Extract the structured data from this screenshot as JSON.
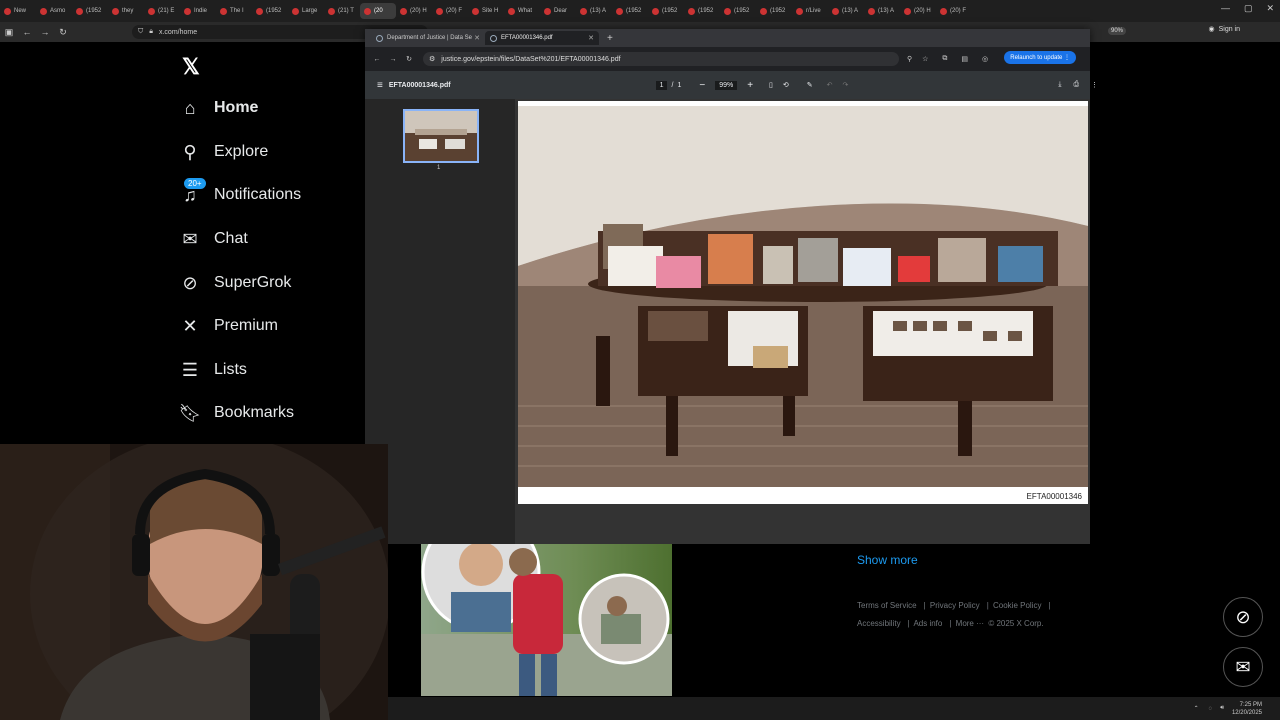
{
  "browser": {
    "tabs": [
      {
        "label": "New"
      },
      {
        "label": "Asmo"
      },
      {
        "label": "(1952"
      },
      {
        "label": "they"
      },
      {
        "label": "(21) E"
      },
      {
        "label": "Indie"
      },
      {
        "label": "The I"
      },
      {
        "label": "(1952"
      },
      {
        "label": "Large"
      },
      {
        "label": "(21) T"
      },
      {
        "label": "(20"
      },
      {
        "label": "(20) H"
      },
      {
        "label": "(20) F"
      },
      {
        "label": "Site H"
      },
      {
        "label": "What"
      },
      {
        "label": "Dear"
      },
      {
        "label": "(13) A"
      },
      {
        "label": "(1952"
      },
      {
        "label": "(1952"
      },
      {
        "label": "(1952"
      },
      {
        "label": "(1952"
      },
      {
        "label": "(1952"
      },
      {
        "label": "r/Live"
      },
      {
        "label": "(13) A"
      },
      {
        "label": "(13) A"
      },
      {
        "label": "(20) H"
      },
      {
        "label": "(20) F"
      }
    ],
    "active_tab_index": 10,
    "url": "x.com/home",
    "zoom": "90%",
    "sign_in": "Sign in"
  },
  "sidebar": {
    "items": [
      {
        "label": "Home",
        "icon": "home-icon"
      },
      {
        "label": "Explore",
        "icon": "search-icon"
      },
      {
        "label": "Notifications",
        "icon": "bell-icon"
      },
      {
        "label": "Chat",
        "icon": "mail-icon"
      },
      {
        "label": "SuperGrok",
        "icon": "grok-icon"
      },
      {
        "label": "Premium",
        "icon": "x-icon"
      },
      {
        "label": "Lists",
        "icon": "list-icon"
      },
      {
        "label": "Bookmarks",
        "icon": "bookmark-icon"
      }
    ],
    "notifications_badge": "20+"
  },
  "pdf_window": {
    "tabs": [
      {
        "label": "Department of Justice | Data Se"
      },
      {
        "label": "EFTA00001346.pdf"
      }
    ],
    "url": "justice.gov/epstein/files/DataSet%201/EFTA00001346.pdf",
    "relaunch_label": "Relaunch to update",
    "toolbar": {
      "title": "EFTA00001346.pdf",
      "page_current": "1",
      "page_total": "1",
      "zoom": "99%"
    },
    "thumbnail_page_label": "1",
    "page_footer": "EFTA00001346"
  },
  "right_column": {
    "show_more": "Show more",
    "footer_links": [
      "Terms of Service",
      "Privacy Policy",
      "Cookie Policy",
      "Accessibility",
      "Ads info",
      "More ···",
      "© 2025 X Corp."
    ]
  },
  "taskbar": {
    "time": "7:25 PM",
    "date": "12/20/2025"
  },
  "colors": {
    "accent": "#1d9bf0",
    "relaunch": "#1a73e8"
  }
}
